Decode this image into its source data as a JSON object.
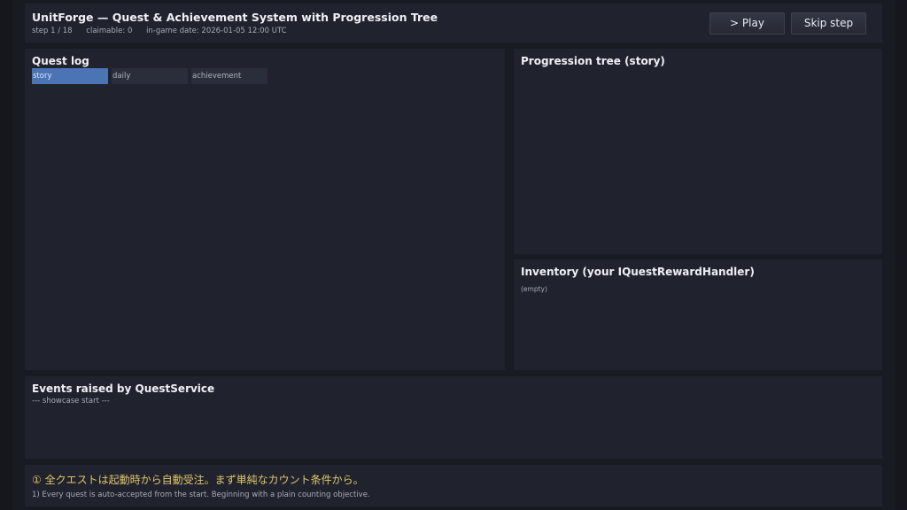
{
  "header": {
    "title": "UnitForge — Quest & Achievement System with Progression Tree",
    "step": "step 1 / 18",
    "claimable": "claimable: 0",
    "date": "in-game date: 2026-01-05 12:00 UTC",
    "play_label": "> Play",
    "skip_label": "Skip step"
  },
  "quest_log": {
    "title": "Quest log",
    "tabs": [
      {
        "label": "story",
        "active": true
      },
      {
        "label": "daily",
        "active": false
      },
      {
        "label": "achievement",
        "active": false
      }
    ]
  },
  "progression": {
    "title": "Progression tree (story)"
  },
  "inventory": {
    "title": "Inventory (your IQuestRewardHandler)",
    "empty_label": "(empty)"
  },
  "events": {
    "title": "Events raised by QuestService",
    "lines": [
      "--- showcase start ---"
    ]
  },
  "footer": {
    "japanese": "① 全クエストは起動時から自動受注。まず単純なカウント条件から。",
    "english": "1) Every quest is auto-accepted from the start. Beginning with a plain counting objective."
  },
  "colors": {
    "accent_tab": "#4a74b4",
    "hint_text": "#e0c66a",
    "panel_bg": "#20232e"
  }
}
